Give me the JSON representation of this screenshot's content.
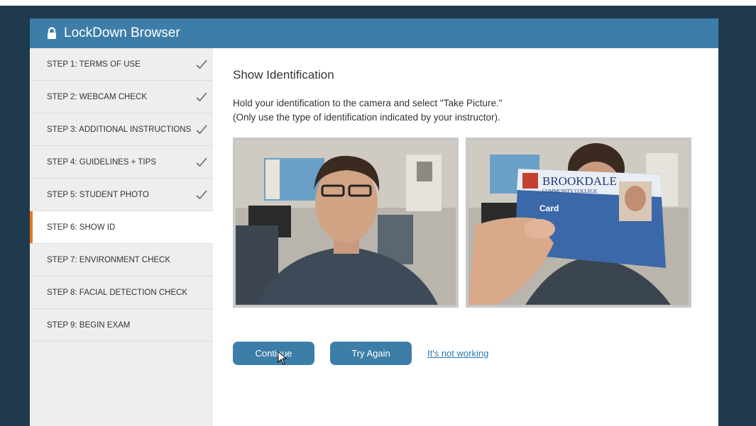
{
  "app": {
    "title": "LockDown Browser"
  },
  "steps": [
    {
      "label": "STEP 1: TERMS OF USE",
      "done": true
    },
    {
      "label": "STEP 2: WEBCAM CHECK",
      "done": true
    },
    {
      "label": "STEP 3: ADDITIONAL INSTRUCTIONS",
      "done": true
    },
    {
      "label": "STEP 4: GUIDELINES + TIPS",
      "done": true
    },
    {
      "label": "STEP 5: STUDENT PHOTO",
      "done": true
    },
    {
      "label": "STEP 6: SHOW ID",
      "done": false,
      "active": true
    },
    {
      "label": "STEP 7: ENVIRONMENT CHECK",
      "done": false
    },
    {
      "label": "STEP 8: FACIAL DETECTION CHECK",
      "done": false
    },
    {
      "label": "STEP 9: BEGIN EXAM",
      "done": false
    }
  ],
  "main": {
    "heading": "Show Identification",
    "line1": "Hold your identification to the camera and select \"Take Picture.\"",
    "line2": "(Only use the type of identification indicated by your instructor).",
    "continue_label": "Continue",
    "try_again_label": "Try Again",
    "not_working_label": "It's not working"
  },
  "id_card": {
    "school_name": "BROOKDALE",
    "school_sub": "COMMUNITY COLLEGE",
    "card_label": "Card"
  },
  "colors": {
    "accent": "#3d7ea8",
    "active_marker": "#e87722",
    "background": "#1f3a4d"
  }
}
